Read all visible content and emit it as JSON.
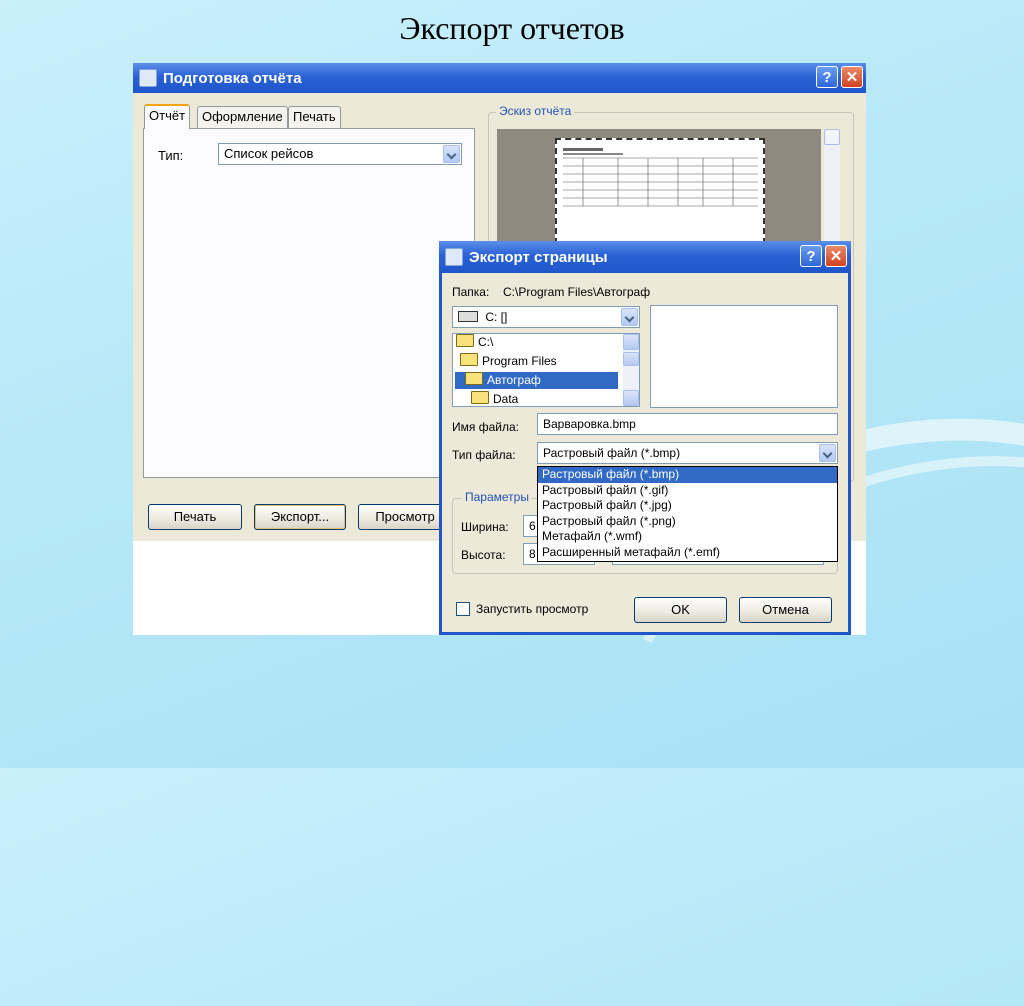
{
  "slide_title": "Экспорт отчетов",
  "main_window": {
    "title": "Подготовка отчёта",
    "help_label": "?",
    "close_label": "✕",
    "tabs": [
      "Отчёт",
      "Оформление",
      "Печать"
    ],
    "type_label": "Тип:",
    "type_value": "Список рейсов",
    "preview_group": "Эскиз отчёта",
    "buttons": {
      "print": "Печать",
      "export": "Экспорт...",
      "preview": "Просмотр"
    }
  },
  "export_dialog": {
    "title": "Экспорт страницы",
    "help_label": "?",
    "close_label": "✕",
    "folder_label": "Папка:",
    "folder_path": "C:\\Program Files\\Автограф",
    "drive": "C: []",
    "tree": [
      "C:\\",
      "Program Files",
      "Автограф",
      "Data"
    ],
    "filename_label": "Имя файла:",
    "filename_value": "Варваровка.bmp",
    "filetype_label": "Тип файла:",
    "filetype_value": "Растровый файл (*.bmp)",
    "filetype_options": [
      "Растровый файл (*.bmp)",
      "Растровый файл (*.gif)",
      "Растровый файл (*.jpg)",
      "Растровый файл (*.png)",
      "Метафайл (*.wmf)",
      "Расширенный метафайл (*.emf)"
    ],
    "params_group": "Параметры",
    "width_label": "Ширина:",
    "width_value": "6",
    "height_label": "Высота:",
    "height_value": "8",
    "launch_preview_label": "Запустить просмотр",
    "ok_label": "OK",
    "cancel_label": "Отмена"
  },
  "colors": {
    "titlebar": "#2a62d6",
    "selection": "#316ac5",
    "window_bg": "#ece9d8"
  }
}
